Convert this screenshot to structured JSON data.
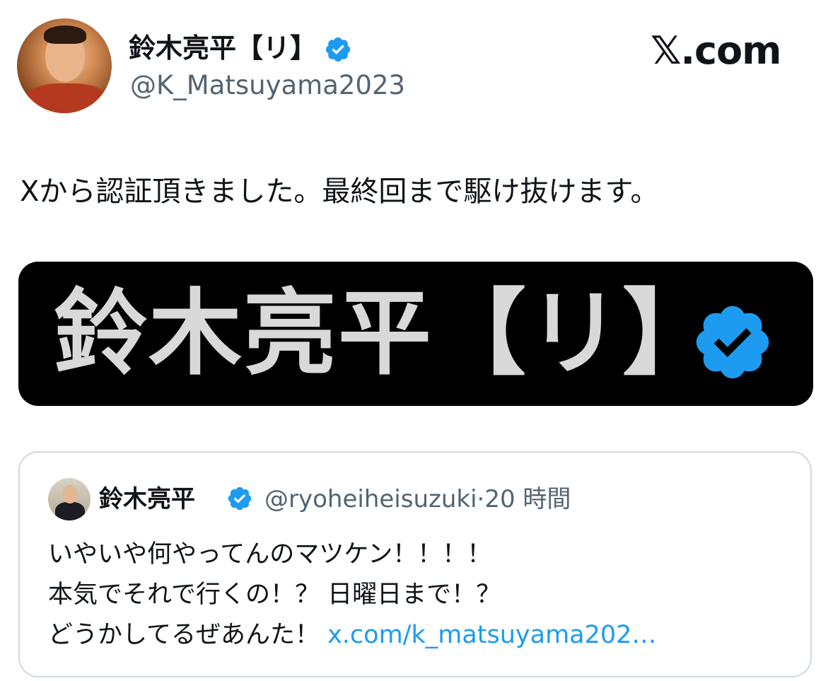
{
  "header": {
    "display_name": "鈴木亮平【リ】",
    "handle": "@K_Matsuyama2023",
    "brand": "𝕏.com"
  },
  "tweet": {
    "text": "Xから認証頂きました。最終回まで駆け抜けます。"
  },
  "media": {
    "text": "鈴木亮平【リ】"
  },
  "quote": {
    "display_name": "鈴木亮平",
    "handle": "@ryoheiheisuzuki",
    "separator": "·",
    "time": "20 時間",
    "lines": [
      "いやいや何やってんのマツケン！！！！",
      "本気でそれで行くの！？ 日曜日まで！？",
      "どうかしてるぜあんた！ "
    ],
    "link": "x.com/k_matsuyama202…"
  },
  "colors": {
    "verified_blue": "#1d9bf0",
    "link_blue": "#1d9bf0",
    "muted_text": "#536471",
    "media_background": "#000000",
    "media_text": "#d9d9d9",
    "border": "#cfd9de"
  },
  "icons": {
    "verified": "verified-badge-icon"
  }
}
